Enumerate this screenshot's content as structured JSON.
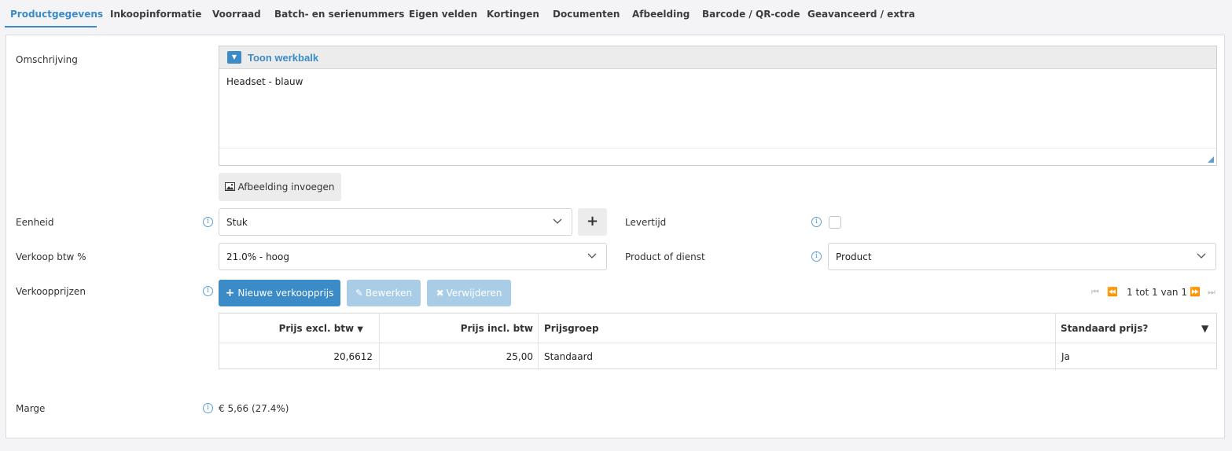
{
  "tabs": [
    {
      "label": "Productgegevens",
      "active": true
    },
    {
      "label": "Inkoopinformatie"
    },
    {
      "label": "Voorraad"
    },
    {
      "label": "Batch- en serienummers"
    },
    {
      "label": "Eigen velden"
    },
    {
      "label": "Kortingen"
    },
    {
      "label": "Documenten"
    },
    {
      "label": "Afbeelding"
    },
    {
      "label": "Barcode / QR-code"
    },
    {
      "label": "Geavanceerd / extra"
    }
  ],
  "description": {
    "label": "Omschrijving",
    "toolbar_toggle": "Toon werkbalk",
    "value": "Headset - blauw",
    "insert_image_button": "Afbeelding invoegen"
  },
  "unit": {
    "label": "Eenheid",
    "value": "Stuk",
    "add_button": "+"
  },
  "delivery_time": {
    "label": "Levertijd",
    "checked": false
  },
  "vat": {
    "label": "Verkoop btw %",
    "value": "21.0% - hoog"
  },
  "product_or_service": {
    "label": "Product of dienst",
    "value": "Product"
  },
  "sales_prices": {
    "label": "Verkoopprijzen",
    "new_button": "Nieuwe verkoopprijs",
    "edit_button": "Bewerken",
    "delete_button": "Verwijderen",
    "pager_text": "1 tot 1 van 1",
    "columns": [
      "Prijs excl. btw",
      "Prijs incl. btw",
      "Prijsgroep",
      "Standaard prijs?"
    ],
    "rows": [
      {
        "excl": "20,6612",
        "incl": "25,00",
        "group": "Standaard",
        "default": "Ja"
      }
    ]
  },
  "margin": {
    "label": "Marge",
    "value": "€ 5,66 (27.4%)"
  },
  "colors": {
    "accent": "#3a8bc7",
    "disabled": "#a9cde6",
    "background": "#f4f4f6"
  }
}
